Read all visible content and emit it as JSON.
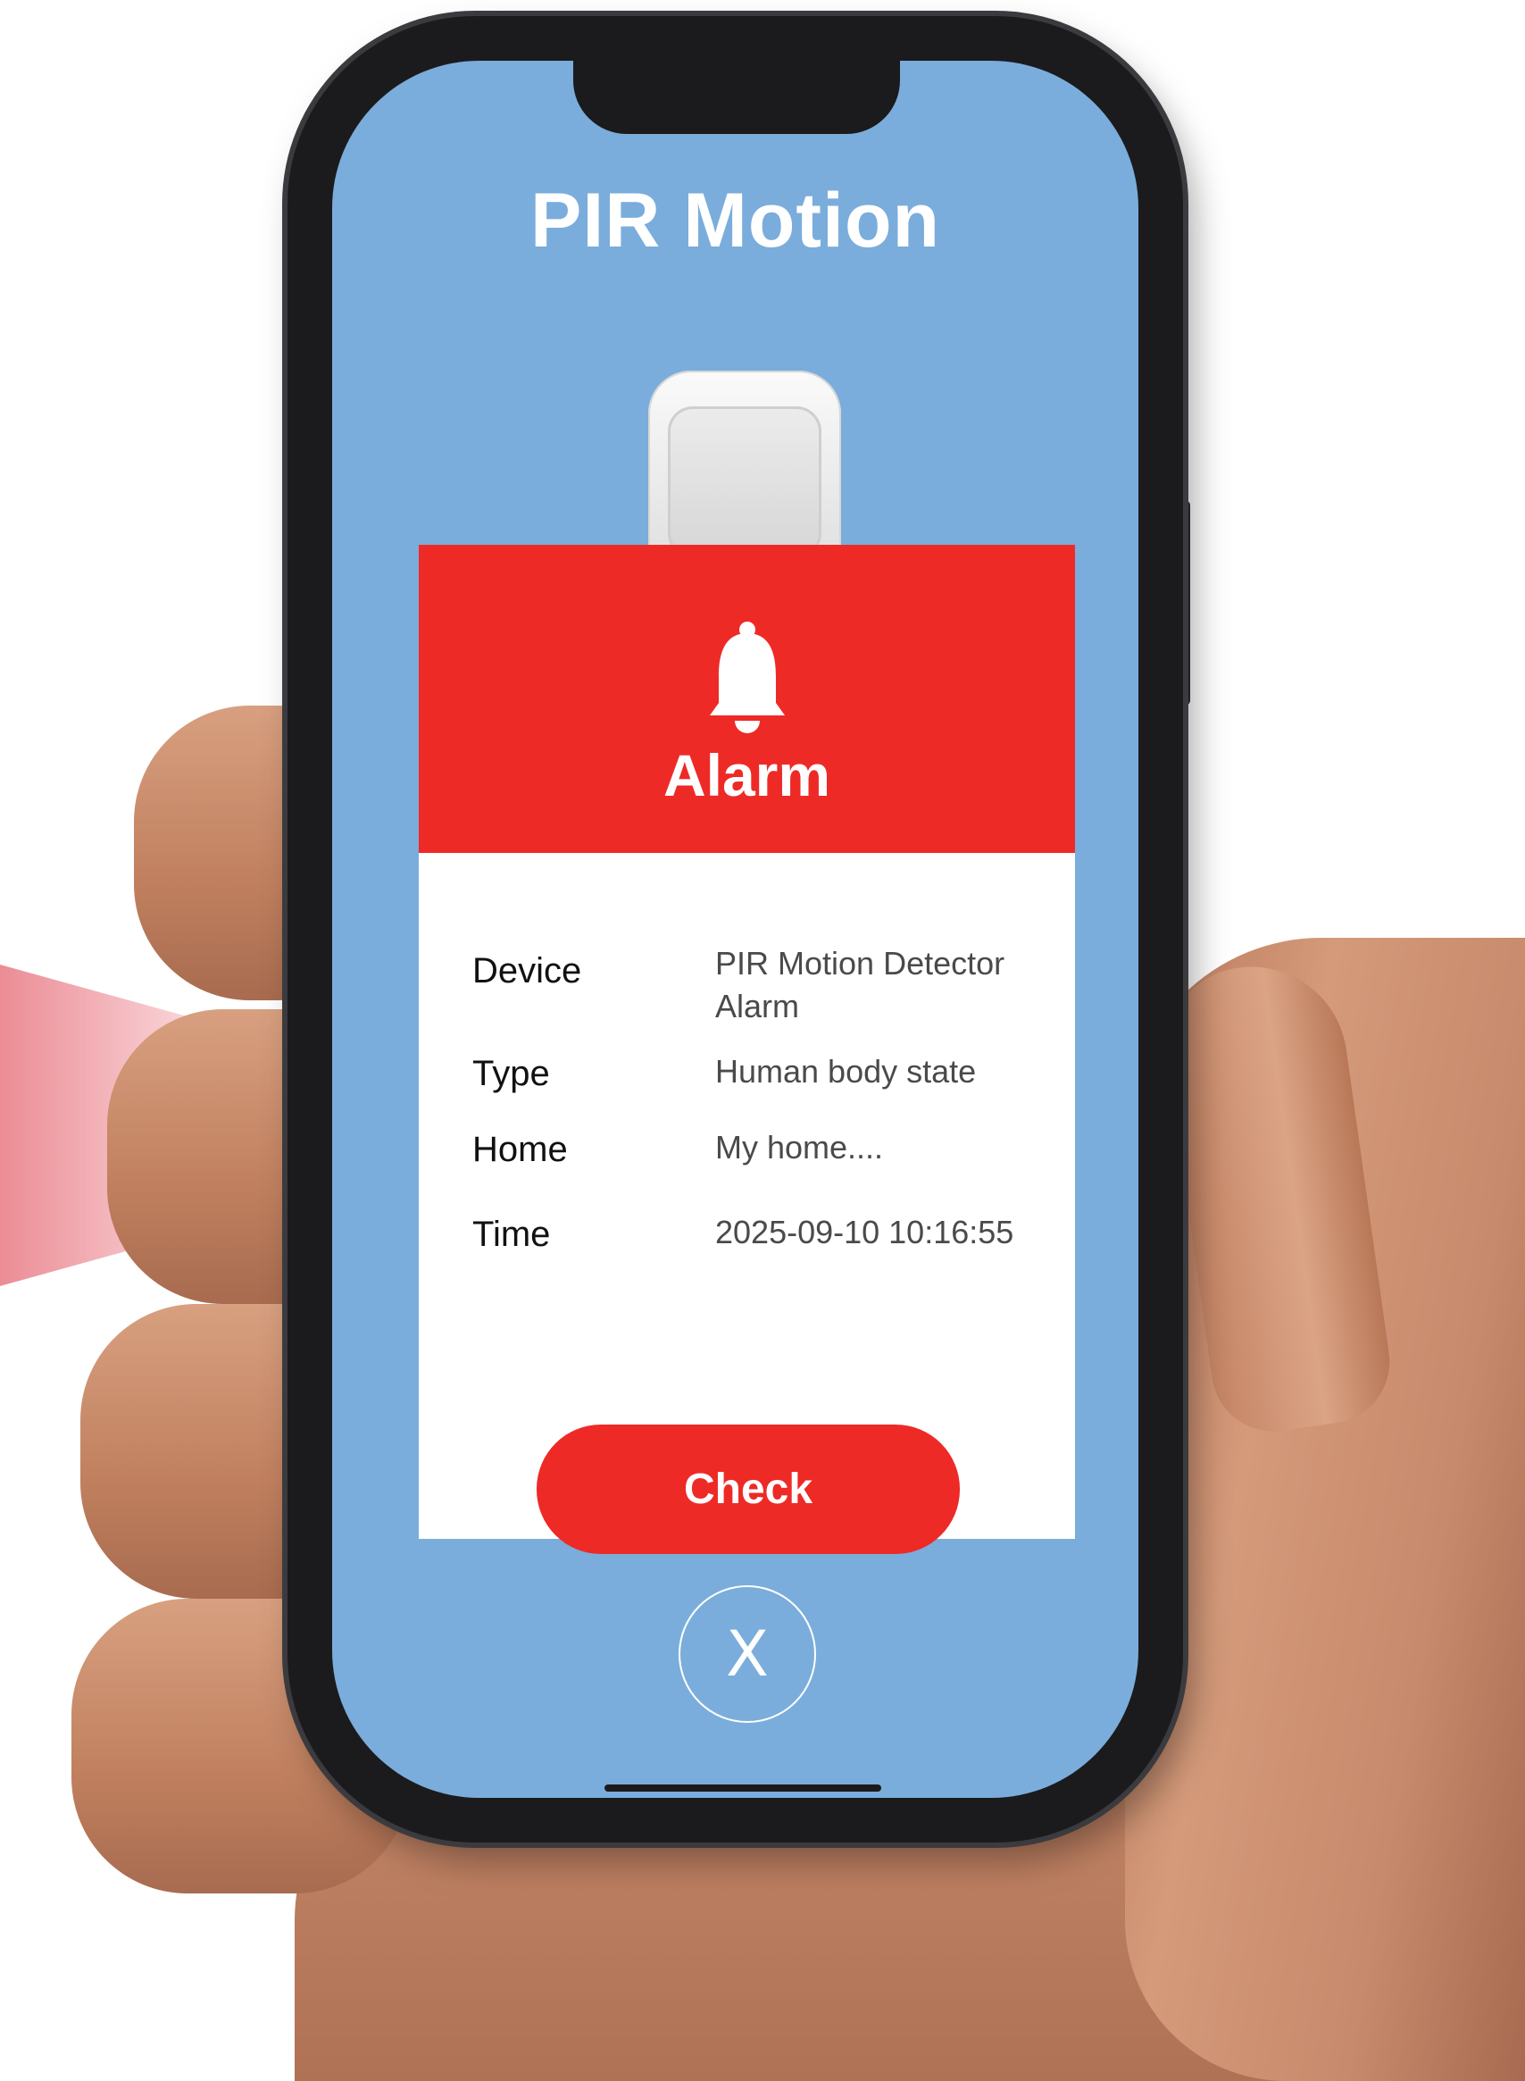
{
  "screen": {
    "title": "PIR Motion",
    "background_color": "#7aaddb"
  },
  "alarm_card": {
    "header_title": "Alarm",
    "header_icon": "bell-icon",
    "accent_color": "#ee2a27",
    "details": [
      {
        "label": "Device",
        "value": "PIR Motion Detector Alarm"
      },
      {
        "label": "Type",
        "value": "Human body state"
      },
      {
        "label": "Home",
        "value": "My home...."
      },
      {
        "label": "Time",
        "value": "2025-09-10 10:16:55"
      }
    ],
    "check_label": "Check"
  },
  "close_button": {
    "label": "X",
    "icon": "close-icon"
  }
}
